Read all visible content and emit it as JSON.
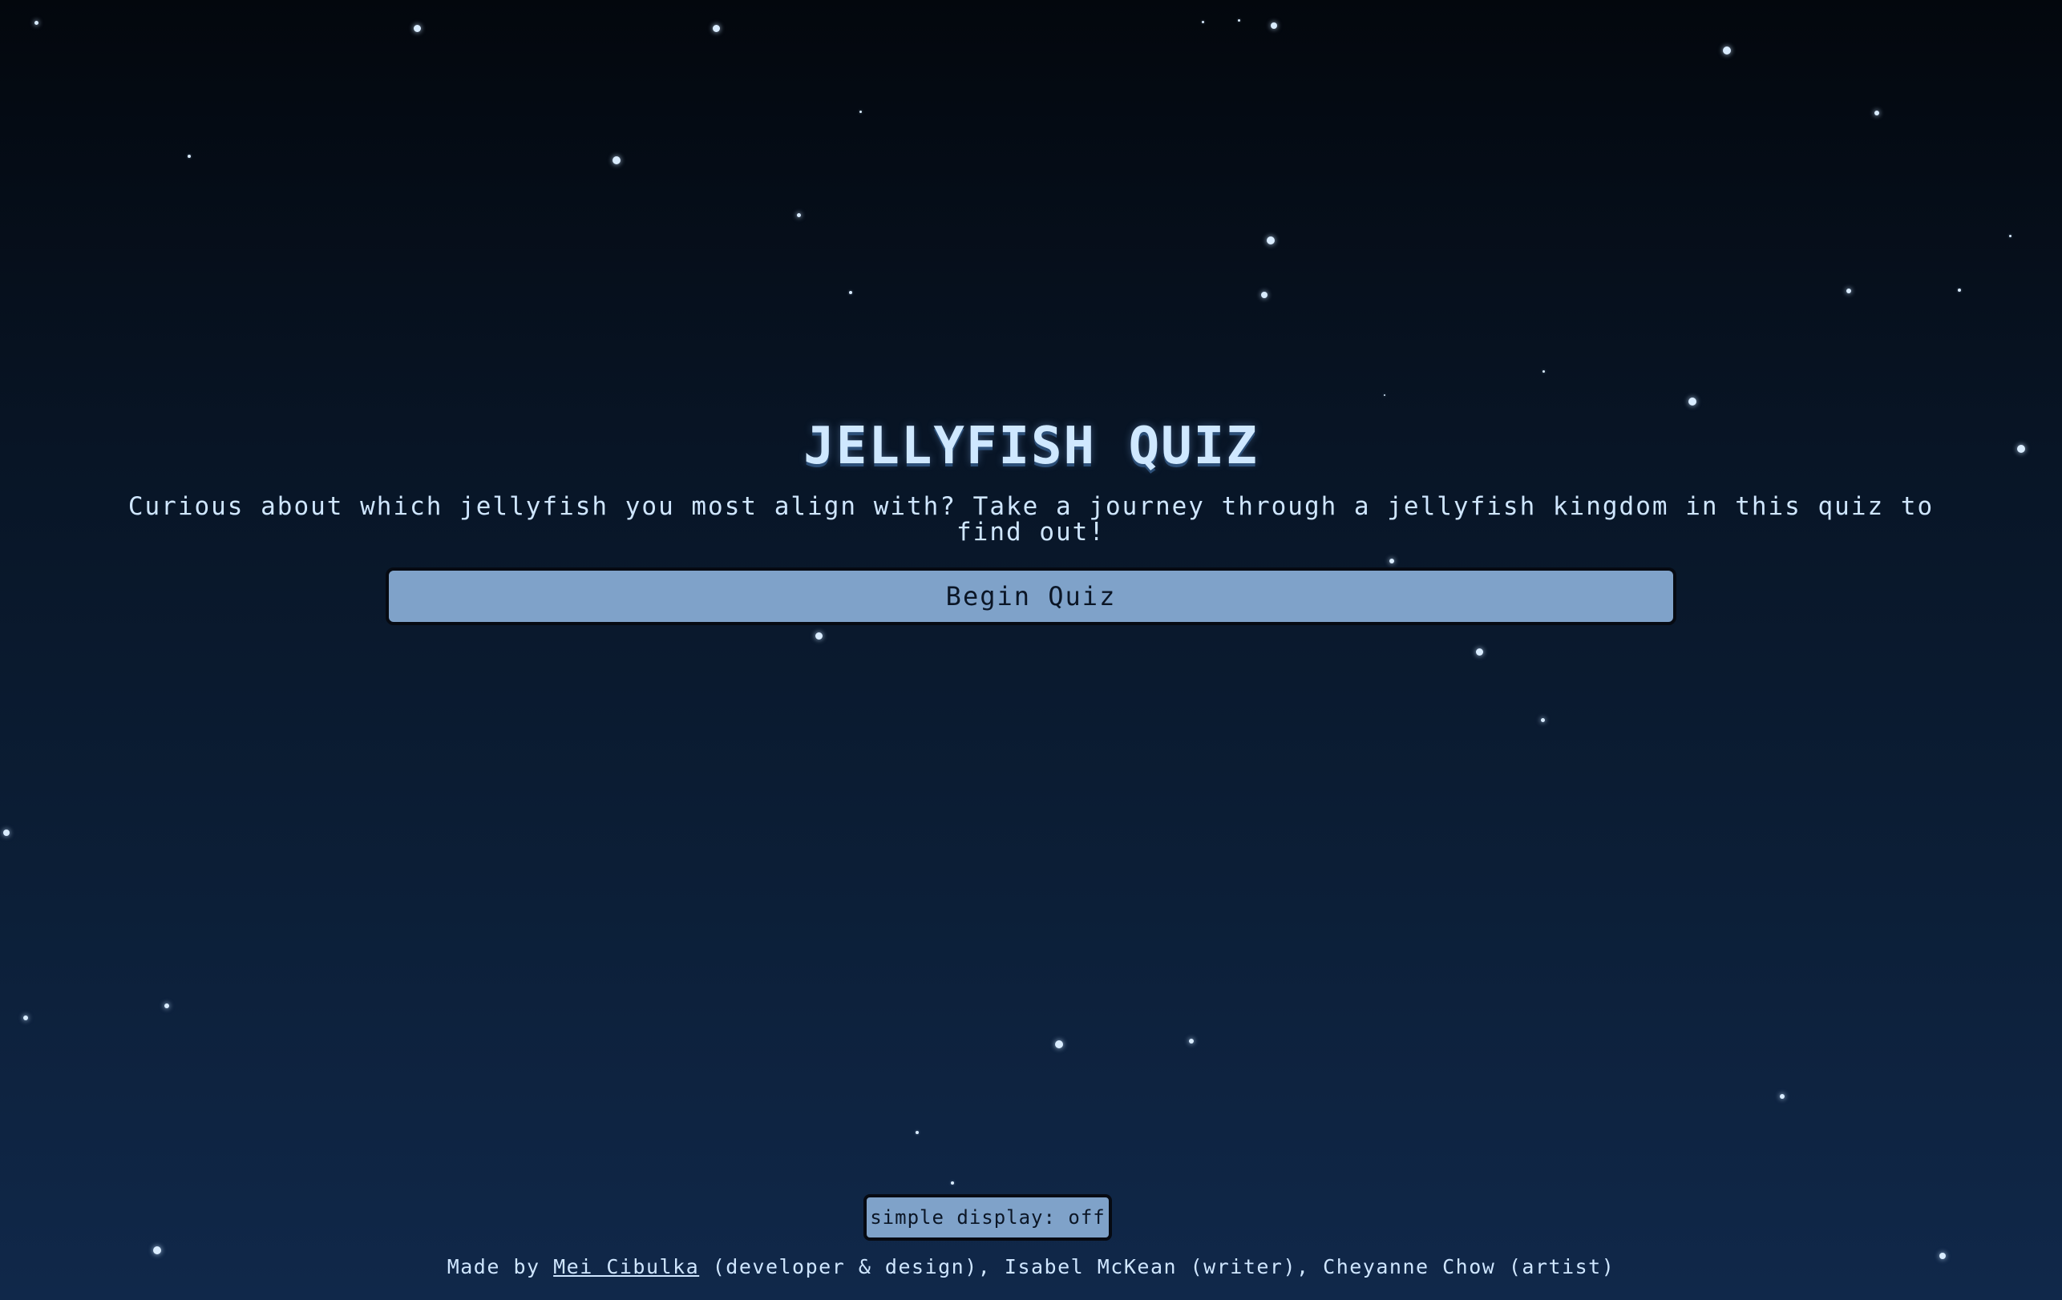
{
  "page": {
    "title": "JELLYFISH QUIZ",
    "subtitle": "Curious about which jellyfish you most align with? Take a journey through a jellyfish kingdom in this quiz to find out!",
    "begin_button": "Begin Quiz"
  },
  "display_toggle": {
    "label": "simple display: off"
  },
  "credits": {
    "prefix": "Made by ",
    "developer_name": "Mei Cibulka",
    "developer_role": " (developer & design), ",
    "writer_name": "Isabel McKean",
    "writer_role": " (writer), ",
    "artist_name": "Cheyanne Chow",
    "artist_role": " (artist)"
  },
  "colors": {
    "background_top": "#03070d",
    "background_bottom": "#10284a",
    "accent_button": "#7fa2c9",
    "text": "#cfe6ff",
    "star": "#d9ecff"
  }
}
